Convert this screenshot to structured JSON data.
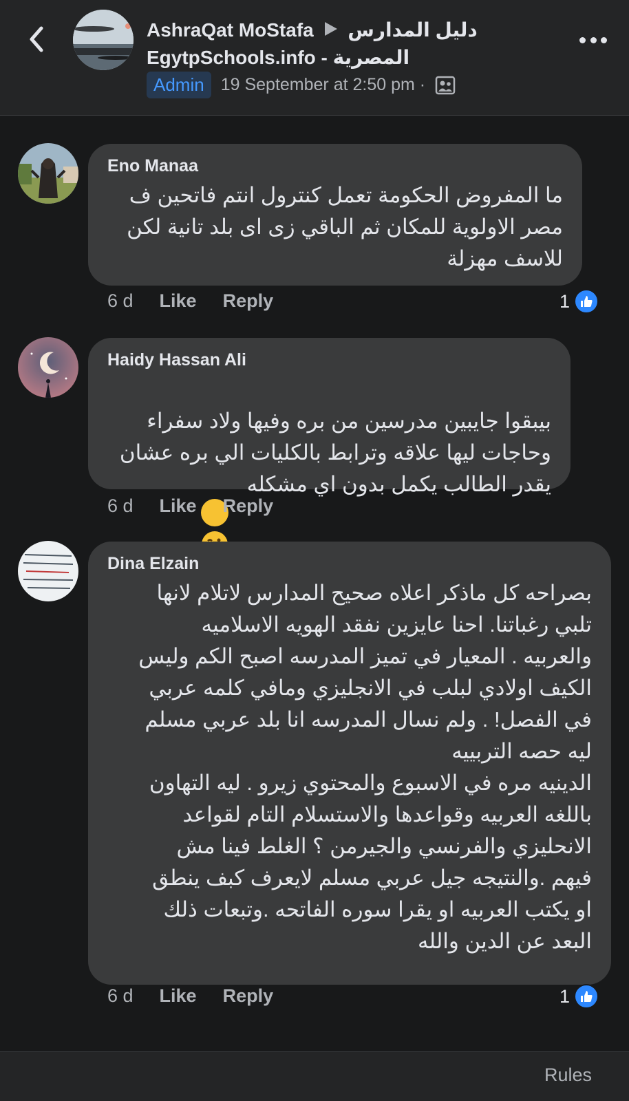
{
  "header": {
    "author": "AshraQat MoStafa",
    "group_line1": "دليل المدارس",
    "group_line2": "EgytpSchools.info - المصرية",
    "badge": "Admin",
    "timestamp": "19 September at 2:50 pm ·",
    "privacy_icon": "group-members-icon",
    "more_icon": "more-dots-icon",
    "back_icon": "chevron-left-icon"
  },
  "peek_row": "1 · Like · Reply",
  "comments": [
    {
      "author": "Eno Manaa",
      "text": "ما المفروض الحكومة تعمل كنترول انتم فاتحين ف\nمصر الاولوية للمكان ثم الباقي زى اى بلد تانية لكن\nللاسف مهزلة",
      "time": "6 d",
      "like": "Like",
      "reply": "Reply",
      "reactions": "1"
    },
    {
      "author": "Haidy Hassan Ali",
      "text": "بيبقوا جايبين مدرسين من بره وفيها ولاد سفراء\nوحاجات ليها علاقه وترابط بالكليات الي بره عشان\nيقدر الطالب يكمل بدون اي مشكله",
      "emoji": "woozy-face-emoji",
      "time": "6 d",
      "like": "Like",
      "reply": "Reply"
    },
    {
      "author": "Dina Elzain",
      "text": "بصراحه كل ماذكر اعلاه صحيح المدارس لاتلام لانها\nتلبي رغباتنا. احنا عايزين نفقد الهويه الاسلاميه\nوالعربيه . المعيار في تميز المدرسه اصبح الكم وليس\nالكيف اولادي لبلب في الانجليزي ومافي كلمه عربي\nفي الفصل! . ولم نسال المدرسه انا بلد عربي مسلم\nليه حصه التربييه\nالدينيه مره في الاسبوع والمحتوي زيرو . ليه التهاون\nباللغه العربيه وقواعدها والاستسلام التام لقواعد\nالانحليزي والفرنسي والجيرمن ؟ الغلط فينا مش\nفيهم .والنتيجه جيل عربي مسلم لايعرف كبف ينطق\nاو يكتب العربيه او يقرا سوره الفاتحه .وتبعات ذلك\nالبعد عن الدين والله",
      "time": "6 d",
      "like": "Like",
      "reply": "Reply",
      "reactions": "1"
    }
  ],
  "footer": {
    "rules": "Rules"
  },
  "colors": {
    "background": "#18191a",
    "bubble": "#3a3b3c",
    "accent": "#2d88ff",
    "admin_badge_bg": "#263951",
    "admin_badge_text": "#4599ff"
  }
}
